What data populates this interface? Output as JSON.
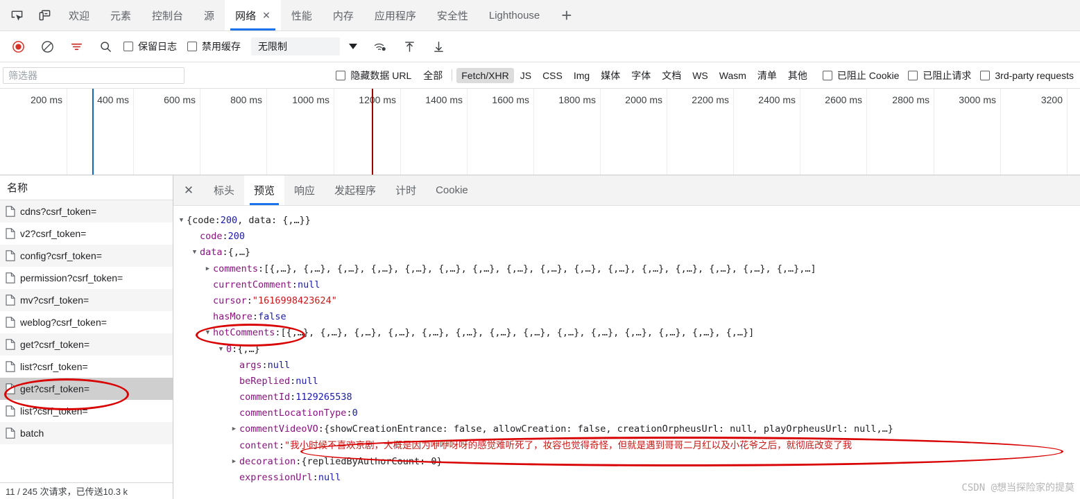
{
  "window": {
    "left_icons": [
      "inspect-element-icon",
      "device-toolbar-icon"
    ],
    "tabs": [
      {
        "label": "欢迎",
        "active": false,
        "closable": false
      },
      {
        "label": "元素",
        "active": false,
        "closable": false
      },
      {
        "label": "控制台",
        "active": false,
        "closable": false
      },
      {
        "label": "源",
        "active": false,
        "closable": false
      },
      {
        "label": "网络",
        "active": true,
        "closable": true,
        "close_label": "✕"
      },
      {
        "label": "性能",
        "active": false,
        "closable": false
      },
      {
        "label": "内存",
        "active": false,
        "closable": false
      },
      {
        "label": "应用程序",
        "active": false,
        "closable": false
      },
      {
        "label": "安全性",
        "active": false,
        "closable": false
      },
      {
        "label": "Lighthouse",
        "active": false,
        "closable": false
      }
    ],
    "add_tab_label": "+"
  },
  "toolbar": {
    "record_title": "record-button",
    "clear_title": "clear-button",
    "filter_title": "filter-button",
    "search_title": "search-button",
    "preserve_log_label": "保留日志",
    "disable_cache_label": "禁用缓存",
    "throttle_value": "无限制",
    "import_title": "import-har",
    "export_title": "export-har"
  },
  "filterbar": {
    "filter_placeholder": "筛选器",
    "hide_data_urls_label": "隐藏数据 URL",
    "types": [
      {
        "label": "全部",
        "active": false
      },
      {
        "label": "Fetch/XHR",
        "active": true
      },
      {
        "label": "JS",
        "active": false
      },
      {
        "label": "CSS",
        "active": false
      },
      {
        "label": "Img",
        "active": false
      },
      {
        "label": "媒体",
        "active": false
      },
      {
        "label": "字体",
        "active": false
      },
      {
        "label": "文档",
        "active": false
      },
      {
        "label": "WS",
        "active": false
      },
      {
        "label": "Wasm",
        "active": false
      },
      {
        "label": "清单",
        "active": false
      },
      {
        "label": "其他",
        "active": false
      }
    ],
    "blocked_cookies_label": "已阻止 Cookie",
    "blocked_requests_label": "已阻止请求",
    "third_party_label": "3rd-party requests"
  },
  "overview": {
    "ticks": [
      "200 ms",
      "400 ms",
      "600 ms",
      "800 ms",
      "1000 ms",
      "1200 ms",
      "1400 ms",
      "1600 ms",
      "1800 ms",
      "2000 ms",
      "2200 ms",
      "2400 ms",
      "2600 ms",
      "2800 ms",
      "3000 ms",
      "3200"
    ],
    "dcl_marker_color": "#1565c0",
    "load_marker_color": "#9c0000",
    "colors": {
      "green": "#16a34a",
      "blue": "#1c95e0",
      "grey": "#a8a8a8",
      "orange": "#e8a33d",
      "purple": "#cc44cc",
      "selected_outline": "#1a73e8"
    }
  },
  "requests": {
    "column_header": "名称",
    "rows": [
      {
        "name": "cdns?csrf_token=",
        "selected": false
      },
      {
        "name": "v2?csrf_token=",
        "selected": false
      },
      {
        "name": "config?csrf_token=",
        "selected": false
      },
      {
        "name": "permission?csrf_token=",
        "selected": false
      },
      {
        "name": "mv?csrf_token=",
        "selected": false
      },
      {
        "name": "weblog?csrf_token=",
        "selected": false
      },
      {
        "name": "get?csrf_token=",
        "selected": false
      },
      {
        "name": "list?csrf_token=",
        "selected": false
      },
      {
        "name": "get?csrf_token=",
        "selected": true
      },
      {
        "name": "list?csrf_token=",
        "selected": false
      },
      {
        "name": "batch",
        "selected": false
      }
    ],
    "status_text": "11 / 245 次请求，已传送10.3 k"
  },
  "detail": {
    "close_label": "✕",
    "tabs": [
      {
        "label": "标头",
        "active": false
      },
      {
        "label": "预览",
        "active": true
      },
      {
        "label": "响应",
        "active": false
      },
      {
        "label": "发起程序",
        "active": false
      },
      {
        "label": "计时",
        "active": false
      },
      {
        "label": "Cookie",
        "active": false
      }
    ],
    "preview": {
      "root_summary": "{code: 200, data: {,…}}",
      "lines": [
        {
          "indent": 0,
          "arrow": "down",
          "key": "",
          "text_plain": "{code: ",
          "num": "200",
          "tail": ", data: {,…}}"
        },
        {
          "indent": 1,
          "arrow": "none",
          "key": "code",
          "value": "200",
          "vtype": "num"
        },
        {
          "indent": 1,
          "arrow": "down",
          "key": "data",
          "value": "{,…}",
          "vtype": "punc"
        },
        {
          "indent": 2,
          "arrow": "right",
          "key": "comments",
          "value": "[{,…}, {,…}, {,…}, {,…}, {,…}, {,…}, {,…}, {,…}, {,…}, {,…}, {,…}, {,…}, {,…}, {,…}, {,…}, {,…},…]",
          "vtype": "punc"
        },
        {
          "indent": 2,
          "arrow": "none",
          "key": "currentComment",
          "value": "null",
          "vtype": "nul"
        },
        {
          "indent": 2,
          "arrow": "none",
          "key": "cursor",
          "value": "\"1616998423624\"",
          "vtype": "str"
        },
        {
          "indent": 2,
          "arrow": "none",
          "key": "hasMore",
          "value": "false",
          "vtype": "bool"
        },
        {
          "indent": 2,
          "arrow": "down",
          "key": "hotComments",
          "value": "[{,…}, {,…}, {,…}, {,…}, {,…}, {,…}, {,…}, {,…}, {,…}, {,…}, {,…}, {,…}, {,…}, {,…}]",
          "vtype": "punc",
          "annotated": true
        },
        {
          "indent": 3,
          "arrow": "down",
          "key": "0",
          "value": "{,…}",
          "vtype": "punc"
        },
        {
          "indent": 4,
          "arrow": "none",
          "key": "args",
          "value": "null",
          "vtype": "nul"
        },
        {
          "indent": 4,
          "arrow": "none",
          "key": "beReplied",
          "value": "null",
          "vtype": "nul"
        },
        {
          "indent": 4,
          "arrow": "none",
          "key": "commentId",
          "value": "1129265538",
          "vtype": "num"
        },
        {
          "indent": 4,
          "arrow": "none",
          "key": "commentLocationType",
          "value": "0",
          "vtype": "num"
        },
        {
          "indent": 4,
          "arrow": "right",
          "key": "commentVideoVO",
          "value": "{showCreationEntrance: false, allowCreation: false, creationOrpheusUrl: null, playOrpheusUrl: null,…}",
          "vtype": "punc"
        },
        {
          "indent": 4,
          "arrow": "none",
          "key": "content",
          "value": "\"我小时候不喜欢京剧，大概是因为咿咿呀呀的感觉难听死了，妆容也觉得奇怪，但就是遇到哥哥二月红以及小花爷之后，就彻底改变了我",
          "vtype": "str",
          "annotated": true
        },
        {
          "indent": 4,
          "arrow": "right",
          "key": "decoration",
          "value": "{repliedByAuthorCount: 0}",
          "vtype": "punc"
        },
        {
          "indent": 4,
          "arrow": "none",
          "key": "expressionUrl",
          "value": "null",
          "vtype": "nul"
        }
      ]
    }
  },
  "watermark": "CSDN @想当探险家的提莫"
}
